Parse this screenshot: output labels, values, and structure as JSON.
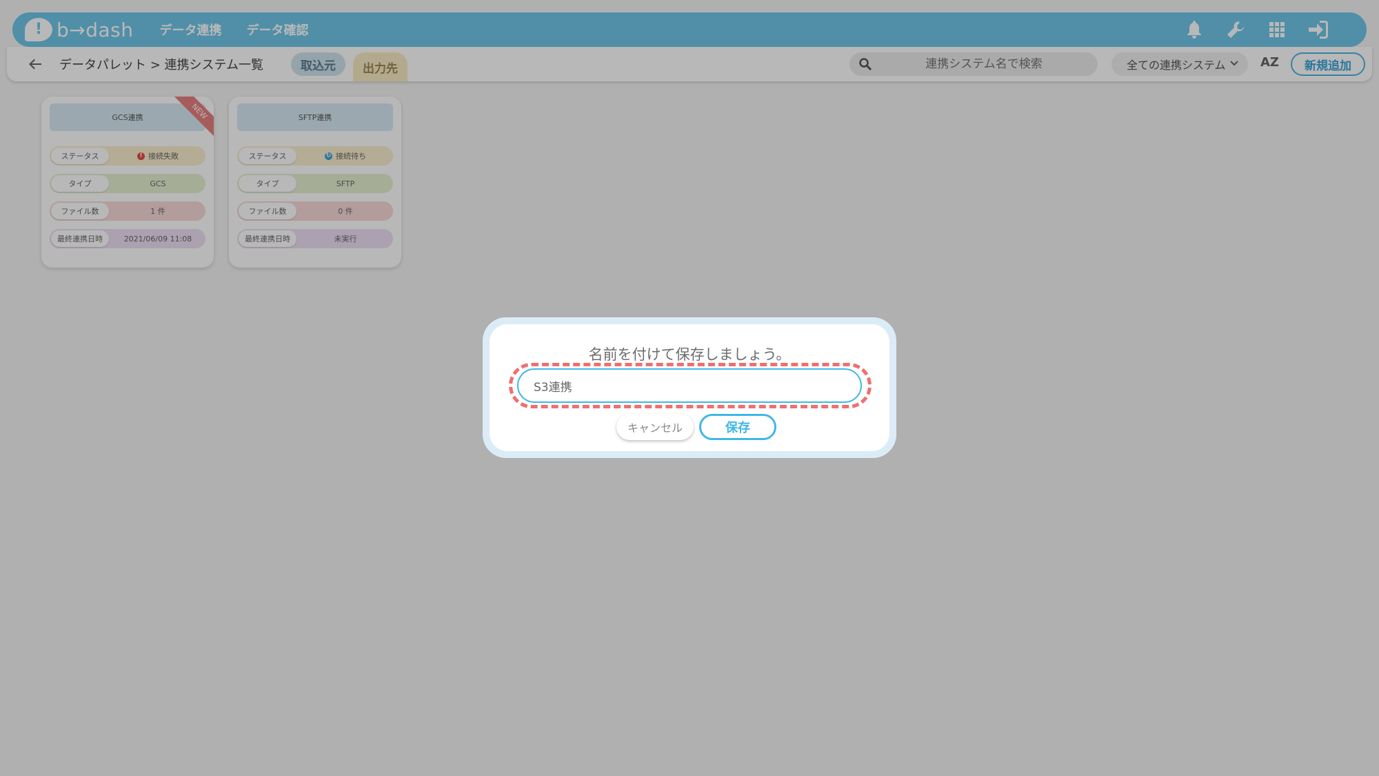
{
  "header": {
    "logo_mark": "!",
    "logo_text": "b→dash",
    "nav": [
      "データ連携",
      "データ確認"
    ],
    "icons": [
      "bell-icon",
      "wrench-icon",
      "grid-icon",
      "logout-icon"
    ]
  },
  "subbar": {
    "breadcrumb": "データパレット > 連携システム一覧",
    "tabs": [
      "取込元",
      "出力先"
    ],
    "search_placeholder": "連携システム名で検索",
    "filter_selected": "全ての連携システム",
    "sort_label": "AZ",
    "new_button": "新規追加"
  },
  "cards": [
    {
      "title": "GCS連携",
      "badge": "NEW",
      "rows": [
        {
          "label": "ステータス",
          "value": "接続失敗"
        },
        {
          "label": "タイプ",
          "value": "GCS"
        },
        {
          "label": "ファイル数",
          "value": "1 件"
        },
        {
          "label": "最終連携日時",
          "value": "2021/06/09 11:08"
        }
      ]
    },
    {
      "title": "SFTP連携",
      "rows": [
        {
          "label": "ステータス",
          "value": "接続待ち"
        },
        {
          "label": "タイプ",
          "value": "SFTP"
        },
        {
          "label": "ファイル数",
          "value": "0 件"
        },
        {
          "label": "最終連携日時",
          "value": "未実行"
        }
      ]
    }
  ],
  "modal": {
    "title": "名前を付けて保存しましょう。",
    "input_value": "S3連携",
    "cancel": "キャンセル",
    "save": "保存"
  },
  "colors": {
    "header_bg": "#6fc6e8",
    "accent": "#3fb7e6",
    "highlight": "#ef6f6f",
    "error": "#e24c4c"
  }
}
